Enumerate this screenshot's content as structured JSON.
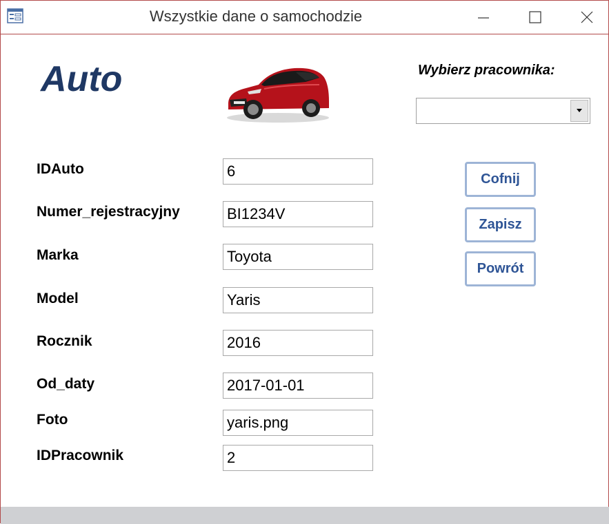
{
  "window": {
    "title": "Wszystkie dane o samochodzie"
  },
  "header": {
    "form_title": "Auto",
    "car_image": "red-hatchback-car-image",
    "select_label": "Wybierz pracownika:",
    "select_value": ""
  },
  "fields": [
    {
      "label": "IDAuto",
      "value": "6"
    },
    {
      "label": "Numer_rejestracyjny",
      "value": "BI1234V"
    },
    {
      "label": "Marka",
      "value": "Toyota"
    },
    {
      "label": "Model",
      "value": "Yaris"
    },
    {
      "label": "Rocznik",
      "value": "2016"
    },
    {
      "label": "Od_daty",
      "value": "2017-01-01"
    },
    {
      "label": "Foto",
      "value": "yaris.png"
    },
    {
      "label": "IDPracownik",
      "value": "2"
    }
  ],
  "buttons": {
    "undo": "Cofnij",
    "save": "Zapisz",
    "back": "Powrót"
  },
  "colors": {
    "title_color": "#1f3864",
    "button_text": "#2f5596",
    "button_border": "#9db4d6",
    "window_border": "#b24a4a"
  }
}
